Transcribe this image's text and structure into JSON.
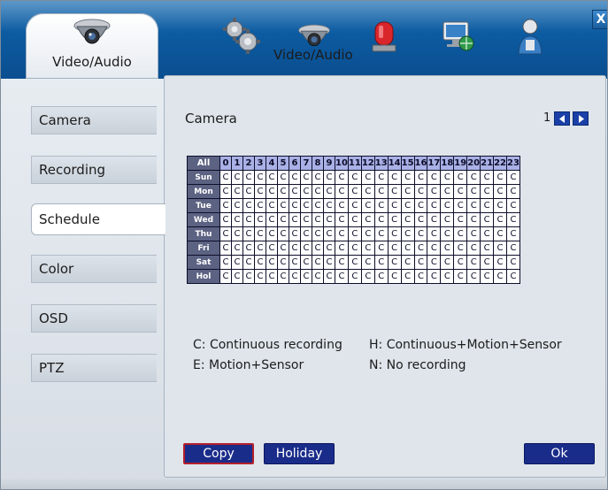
{
  "header": {
    "main_tab_label": "Video/Audio",
    "toolbar_label": "Video/Audio",
    "close_label": "X",
    "icons": [
      "camera-icon",
      "gears-icon",
      "camera-icon",
      "alarm-icon",
      "network-icon",
      "user-icon"
    ]
  },
  "sidebar": {
    "items": [
      {
        "label": "Camera"
      },
      {
        "label": "Recording"
      },
      {
        "label": "Schedule"
      },
      {
        "label": "Color"
      },
      {
        "label": "OSD"
      },
      {
        "label": "PTZ"
      }
    ],
    "active": "Schedule"
  },
  "main": {
    "title": "Camera",
    "page": "1",
    "grid": {
      "corner": "All",
      "hours": [
        "0",
        "1",
        "2",
        "3",
        "4",
        "5",
        "6",
        "7",
        "8",
        "9",
        "10",
        "11",
        "12",
        "13",
        "14",
        "15",
        "16",
        "17",
        "18",
        "19",
        "20",
        "21",
        "22",
        "23"
      ],
      "rows": [
        {
          "day": "Sun",
          "cells": [
            "C",
            "C",
            "C",
            "C",
            "C",
            "C",
            "C",
            "C",
            "C",
            "C",
            "C",
            "C",
            "C",
            "C",
            "C",
            "C",
            "C",
            "C",
            "C",
            "C",
            "C",
            "C",
            "C",
            "C"
          ]
        },
        {
          "day": "Mon",
          "cells": [
            "C",
            "C",
            "C",
            "C",
            "C",
            "C",
            "C",
            "C",
            "C",
            "C",
            "C",
            "C",
            "C",
            "C",
            "C",
            "C",
            "C",
            "C",
            "C",
            "C",
            "C",
            "C",
            "C",
            "C"
          ]
        },
        {
          "day": "Tue",
          "cells": [
            "C",
            "C",
            "C",
            "C",
            "C",
            "C",
            "C",
            "C",
            "C",
            "C",
            "C",
            "C",
            "C",
            "C",
            "C",
            "C",
            "C",
            "C",
            "C",
            "C",
            "C",
            "C",
            "C",
            "C"
          ]
        },
        {
          "day": "Wed",
          "cells": [
            "C",
            "C",
            "C",
            "C",
            "C",
            "C",
            "C",
            "C",
            "C",
            "C",
            "C",
            "C",
            "C",
            "C",
            "C",
            "C",
            "C",
            "C",
            "C",
            "C",
            "C",
            "C",
            "C",
            "C"
          ]
        },
        {
          "day": "Thu",
          "cells": [
            "C",
            "C",
            "C",
            "C",
            "C",
            "C",
            "C",
            "C",
            "C",
            "C",
            "C",
            "C",
            "C",
            "C",
            "C",
            "C",
            "C",
            "C",
            "C",
            "C",
            "C",
            "C",
            "C",
            "C"
          ]
        },
        {
          "day": "Fri",
          "cells": [
            "C",
            "C",
            "C",
            "C",
            "C",
            "C",
            "C",
            "C",
            "C",
            "C",
            "C",
            "C",
            "C",
            "C",
            "C",
            "C",
            "C",
            "C",
            "C",
            "C",
            "C",
            "C",
            "C",
            "C"
          ]
        },
        {
          "day": "Sat",
          "cells": [
            "C",
            "C",
            "C",
            "C",
            "C",
            "C",
            "C",
            "C",
            "C",
            "C",
            "C",
            "C",
            "C",
            "C",
            "C",
            "C",
            "C",
            "C",
            "C",
            "C",
            "C",
            "C",
            "C",
            "C"
          ]
        },
        {
          "day": "Hol",
          "cells": [
            "C",
            "C",
            "C",
            "C",
            "C",
            "C",
            "C",
            "C",
            "C",
            "C",
            "C",
            "C",
            "C",
            "C",
            "C",
            "C",
            "C",
            "C",
            "C",
            "C",
            "C",
            "C",
            "C",
            "C"
          ]
        }
      ]
    },
    "legend": {
      "c": "C: Continuous recording",
      "h": "H: Continuous+Motion+Sensor",
      "e": "E: Motion+Sensor",
      "n": "N: No recording"
    },
    "buttons": {
      "copy": "Copy",
      "holiday": "Holiday",
      "ok": "Ok"
    }
  },
  "colors": {
    "header_blue": "#0c5aa0",
    "button_navy": "#1a2c8a",
    "selected_border": "#b41f2b",
    "grid_header": "#a9b1e6",
    "day_cell": "#5c6282"
  }
}
